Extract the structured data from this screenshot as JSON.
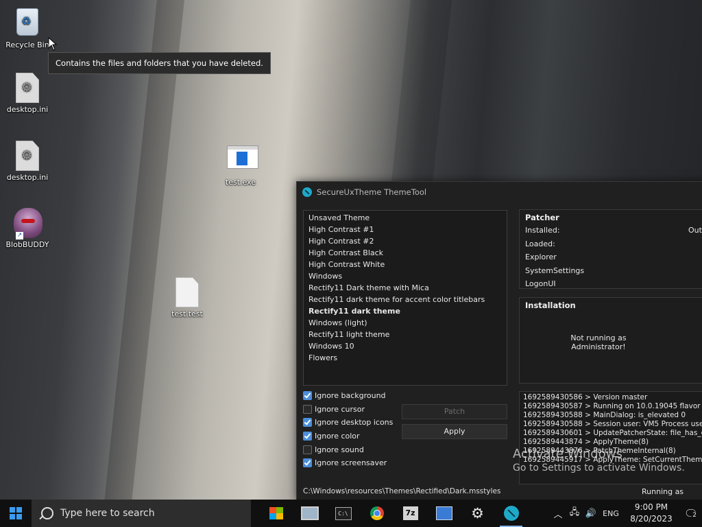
{
  "desktop": {
    "icons": [
      {
        "label": "Recycle Bin"
      },
      {
        "label": "desktop.ini"
      },
      {
        "label": "desktop.ini"
      },
      {
        "label": "BlobBUDDY"
      },
      {
        "label": "test.exe"
      },
      {
        "label": "test.test"
      }
    ],
    "tooltip": "Contains the files and folders that you have deleted."
  },
  "app": {
    "title": "SecureUxTheme ThemeTool",
    "themes": [
      {
        "label": "Unsaved Theme"
      },
      {
        "label": "High Contrast #1"
      },
      {
        "label": "High Contrast #2"
      },
      {
        "label": "High Contrast Black"
      },
      {
        "label": "High Contrast White"
      },
      {
        "label": "Windows"
      },
      {
        "label": "Rectify11 Dark theme with Mica"
      },
      {
        "label": "Rectify11 dark theme for accent color titlebars"
      },
      {
        "label": "Rectify11 dark theme"
      },
      {
        "label": "Windows (light)"
      },
      {
        "label": "Rectify11 light theme"
      },
      {
        "label": "Windows 10"
      },
      {
        "label": "Flowers"
      }
    ],
    "selected_theme": "Rectify11 dark theme",
    "options": [
      {
        "label": "Ignore background",
        "checked": true
      },
      {
        "label": "Ignore cursor",
        "checked": false
      },
      {
        "label": "Ignore desktop icons",
        "checked": true
      },
      {
        "label": "Ignore color",
        "checked": true
      },
      {
        "label": "Ignore sound",
        "checked": false
      },
      {
        "label": "Ignore screensaver",
        "checked": true
      }
    ],
    "patch_label": "Patch",
    "apply_label": "Apply",
    "theme_path": "C:\\Windows\\resources\\Themes\\Rectified\\Dark.msstyles",
    "patcher": {
      "title": "Patcher",
      "rows": [
        {
          "label": "Installed:",
          "value": "Out"
        },
        {
          "label": "Loaded:",
          "value": ""
        },
        {
          "label": "Explorer",
          "value": ""
        },
        {
          "label": "SystemSettings",
          "value": ""
        },
        {
          "label": "LogonUI",
          "value": ""
        }
      ]
    },
    "installation": {
      "title": "Installation",
      "line1": "Not running as",
      "line2": "Administrator!"
    },
    "log": [
      "1692589430586 > Version master",
      "1692589430587 > Running on 10.0.19045 flavor F",
      "1692589430588 > MainDialog: is_elevated 0",
      "1692589430588 > Session user: VM5 Process user: V",
      "1692589430601 > UpdatePatcherState: file_has_con",
      "1692589443874 > ApplyTheme(8)",
      "1692589443876 > PatchThemeInternal(8)",
      "1692589445917 > ApplyTheme: SetCurrentTheme re"
    ],
    "status": "Running as"
  },
  "watermark": {
    "line1": "Activate Windows",
    "line2": "Go to Settings to activate Windows."
  },
  "taskbar": {
    "search_placeholder": "Type here to search",
    "language": "ENG",
    "time": "9:00 PM",
    "date": "8/20/2023",
    "notification_count": "2",
    "apps": [
      {
        "icon": "store-icon"
      },
      {
        "icon": "this-pc-icon"
      },
      {
        "icon": "command-prompt-icon"
      },
      {
        "icon": "chrome-icon"
      },
      {
        "icon": "7zip-icon"
      },
      {
        "icon": "control-panel-icon"
      },
      {
        "icon": "settings-icon"
      },
      {
        "icon": "securexutheme-icon"
      }
    ]
  }
}
